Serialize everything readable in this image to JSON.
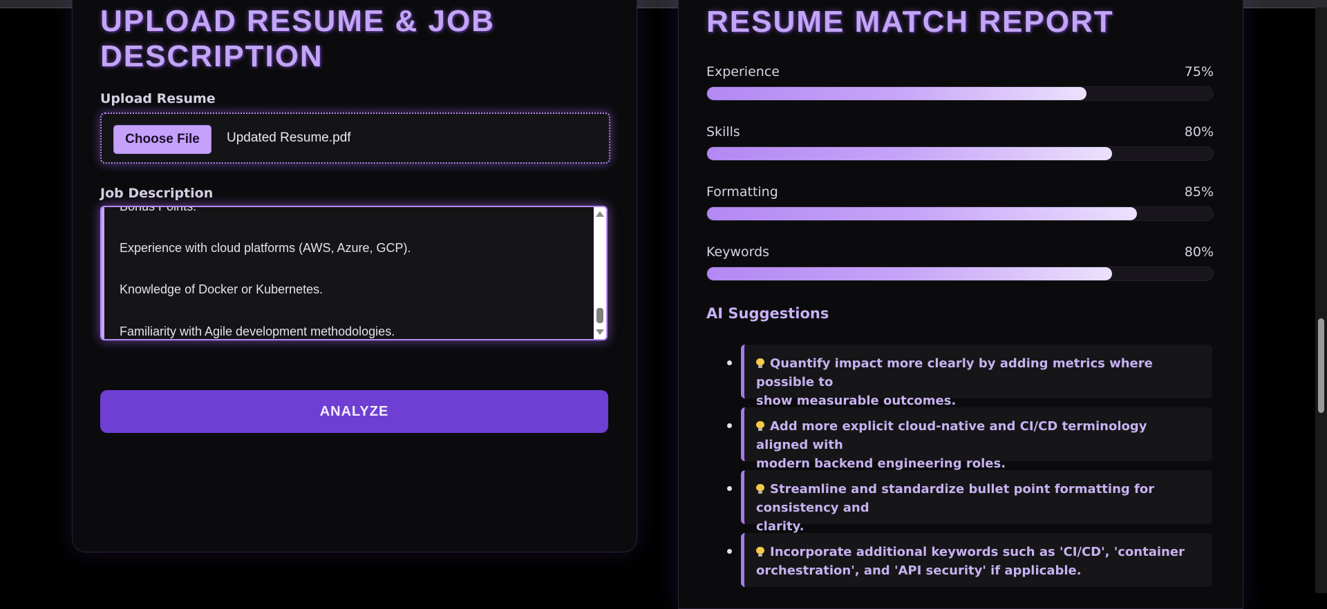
{
  "upload_panel": {
    "heading_line1": "UPLOAD RESUME & JOB",
    "heading_line2": "DESCRIPTION",
    "resume_label": "Upload Resume",
    "choose_file_label": "Choose File",
    "file_name": "Updated Resume.pdf",
    "job_description_label": "Job Description",
    "job_description_lines": [
      "Bonus Points:",
      "Experience with cloud platforms (AWS, Azure, GCP).",
      "Knowledge of Docker or Kubernetes.",
      "Familiarity with Agile development methodologies."
    ],
    "analyze_label": "ANALYZE"
  },
  "report_panel": {
    "heading": "RESUME MATCH REPORT",
    "metrics": [
      {
        "label": "Experience",
        "value": "75%",
        "percent": 75
      },
      {
        "label": "Skills",
        "value": "80%",
        "percent": 80
      },
      {
        "label": "Formatting",
        "value": "85%",
        "percent": 85
      },
      {
        "label": "Keywords",
        "value": "80%",
        "percent": 80
      }
    ],
    "suggestions_title": "AI Suggestions",
    "suggestions": [
      {
        "line1": "Quantify impact more clearly by adding metrics where possible to",
        "line2": "show measurable outcomes."
      },
      {
        "line1": "Add more explicit cloud-native and CI/CD terminology aligned with",
        "line2": "modern backend engineering roles."
      },
      {
        "line1": "Streamline and standardize bullet point formatting for consistency and",
        "line2": "clarity."
      },
      {
        "line1": "Incorporate additional keywords such as 'CI/CD', 'container",
        "line2": "orchestration', and 'API security' if applicable."
      }
    ],
    "suggestion_icon": "lightbulb-icon"
  },
  "colors": {
    "accent": "#c3a5f8",
    "button": "#6f3fd3",
    "background": "#000000",
    "card": "#0b0b0d"
  }
}
